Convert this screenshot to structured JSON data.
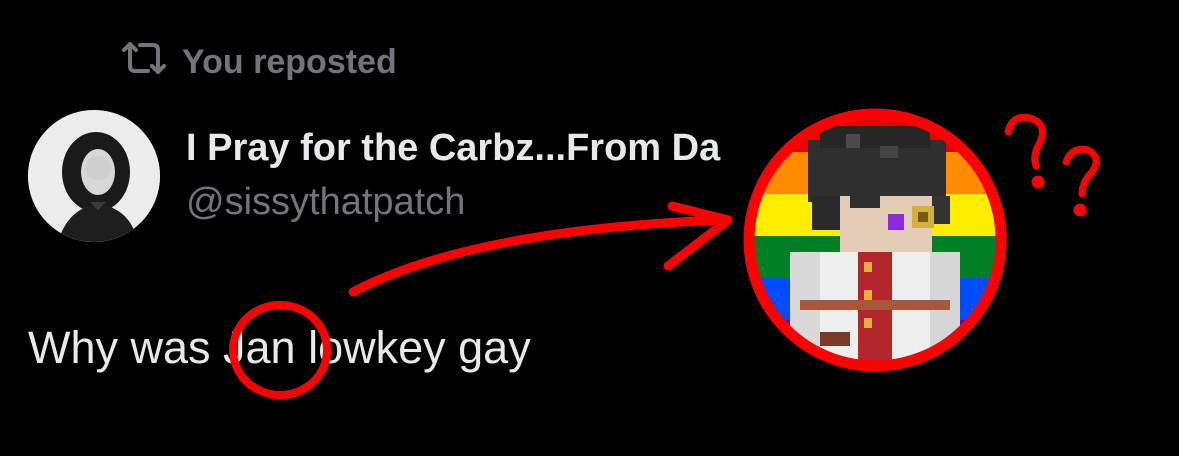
{
  "repost": {
    "label": "You reposted",
    "icon": "repost-icon"
  },
  "post": {
    "display_name": "I Pray for the Carbz...From Da",
    "handle": "@sissythatpatch",
    "text": "Why was Jan lowkey gay"
  },
  "annotation": {
    "question_marks": "? ?"
  },
  "colors": {
    "background": "#000000",
    "primary_text": "#e7e9ea",
    "secondary_text": "#71767b",
    "annotation_red": "#ff0000"
  }
}
